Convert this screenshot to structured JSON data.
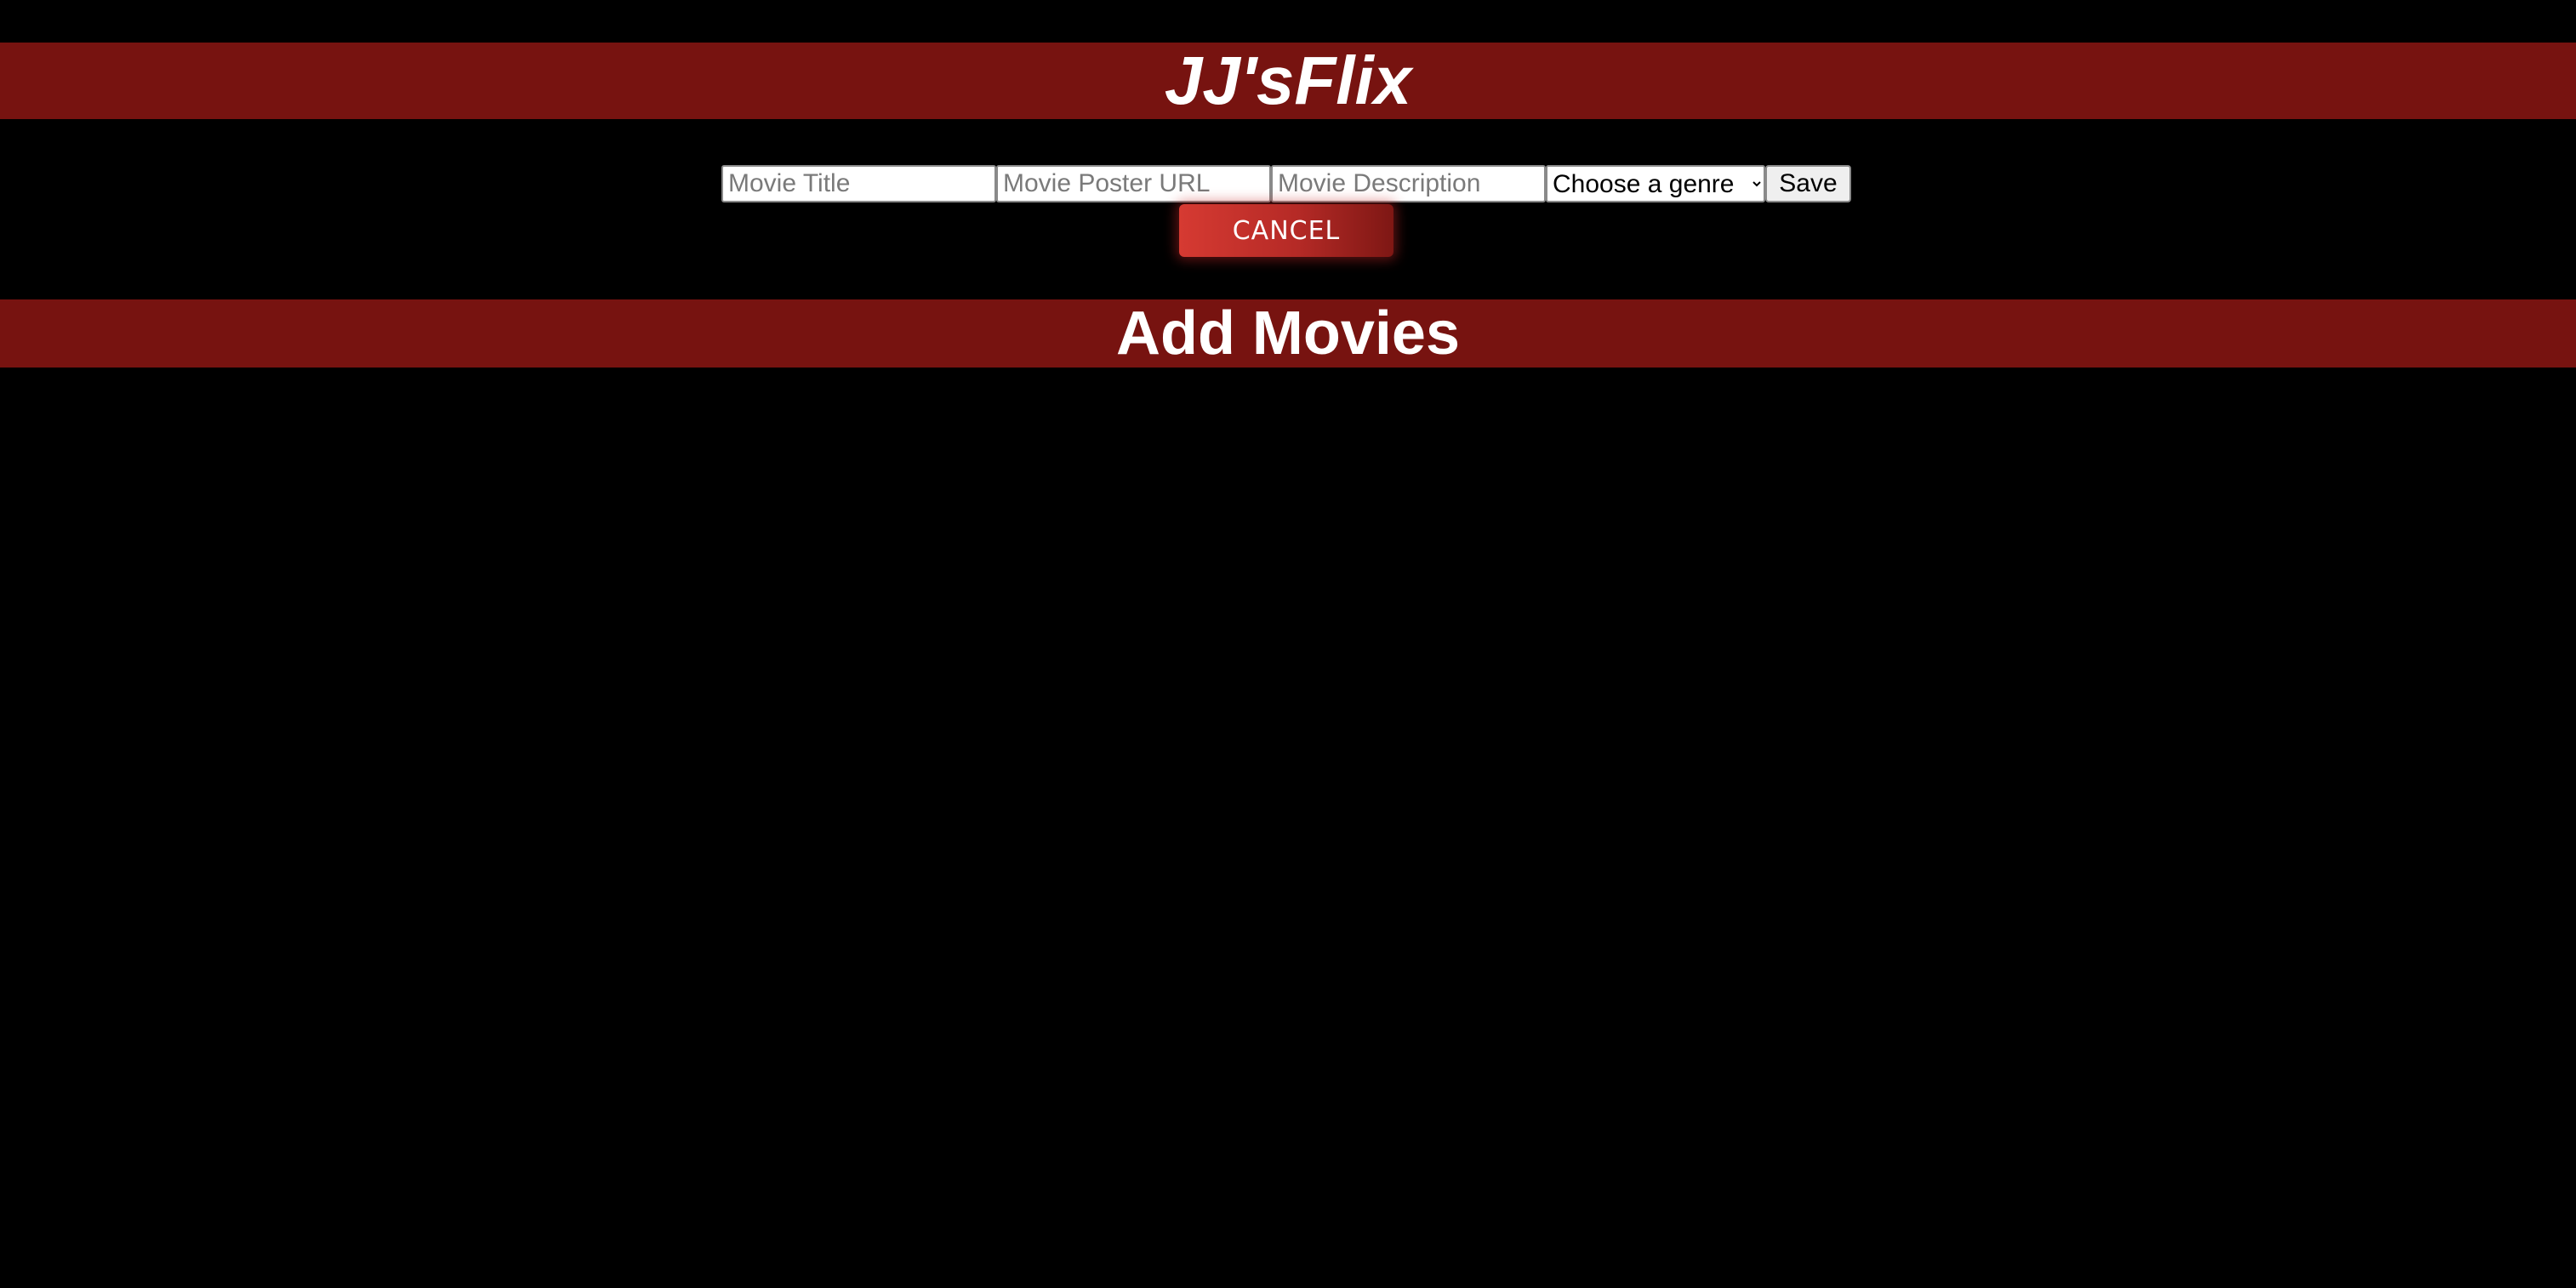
{
  "header": {
    "title": "JJ'sFlix"
  },
  "form": {
    "title_placeholder": "Movie Title",
    "poster_placeholder": "Movie Poster URL",
    "description_placeholder": "Movie Description",
    "genre_selected": "Choose a genre",
    "save_label": "Save",
    "cancel_label": "CANCEL"
  },
  "section": {
    "title": "Add Movies"
  },
  "colors": {
    "background": "#000000",
    "bar": "#771310",
    "accent": "#d63a32"
  }
}
